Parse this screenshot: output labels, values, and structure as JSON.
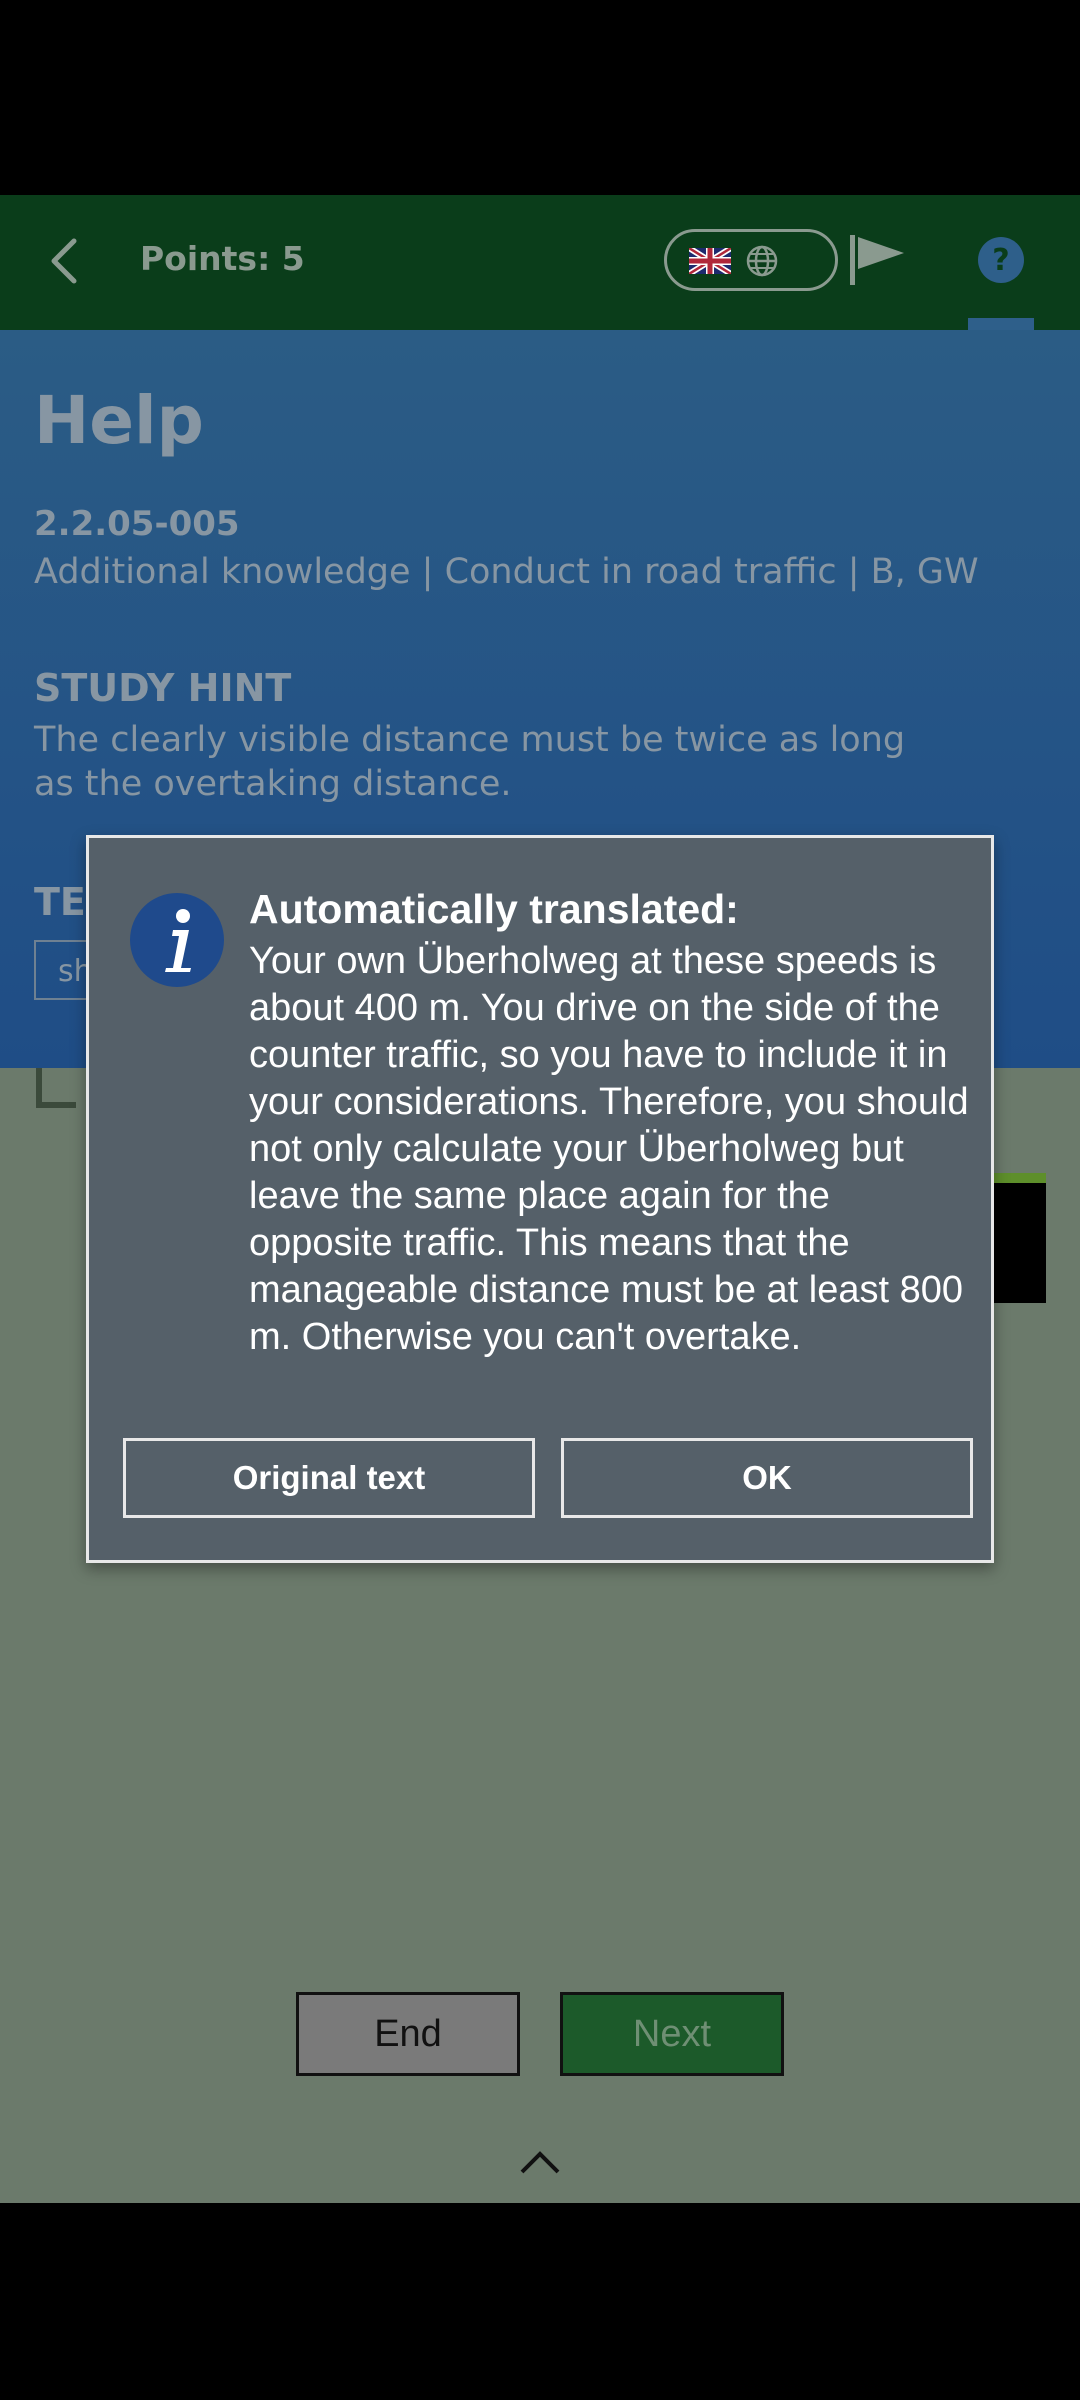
{
  "topbar": {
    "points_label": "Points: 5",
    "colors": {
      "background": "#0a3d1a"
    },
    "icons": [
      "chevron-left-icon",
      "uk-flag-icon",
      "globe-icon",
      "flag-icon",
      "help-icon"
    ]
  },
  "help": {
    "title": "Help",
    "question_id": "2.2.05-005",
    "category": "Additional knowledge | Conduct in road traffic | B, GW",
    "study_hint_label": "STUDY HINT",
    "study_hint_text": "The clearly visible distance must be twice as long as the overtaking distance.",
    "tea_label": "TEA",
    "tea_chip": "sh"
  },
  "dialog": {
    "title": "Automatically translated:",
    "body": "Your own Überholweg at these speeds is about 400 m. You drive on the side of the counter traffic, so you have to include it in your considerations. Therefore, you should not only calculate your Überholweg but leave the same place again for the opposite traffic. This means that the manageable distance must be at least 800 m. Otherwise you can't overtake.",
    "original_button": "Original text",
    "ok_button": "OK",
    "icon": "info-icon"
  },
  "footer": {
    "end_button": "End",
    "next_button": "Next"
  }
}
